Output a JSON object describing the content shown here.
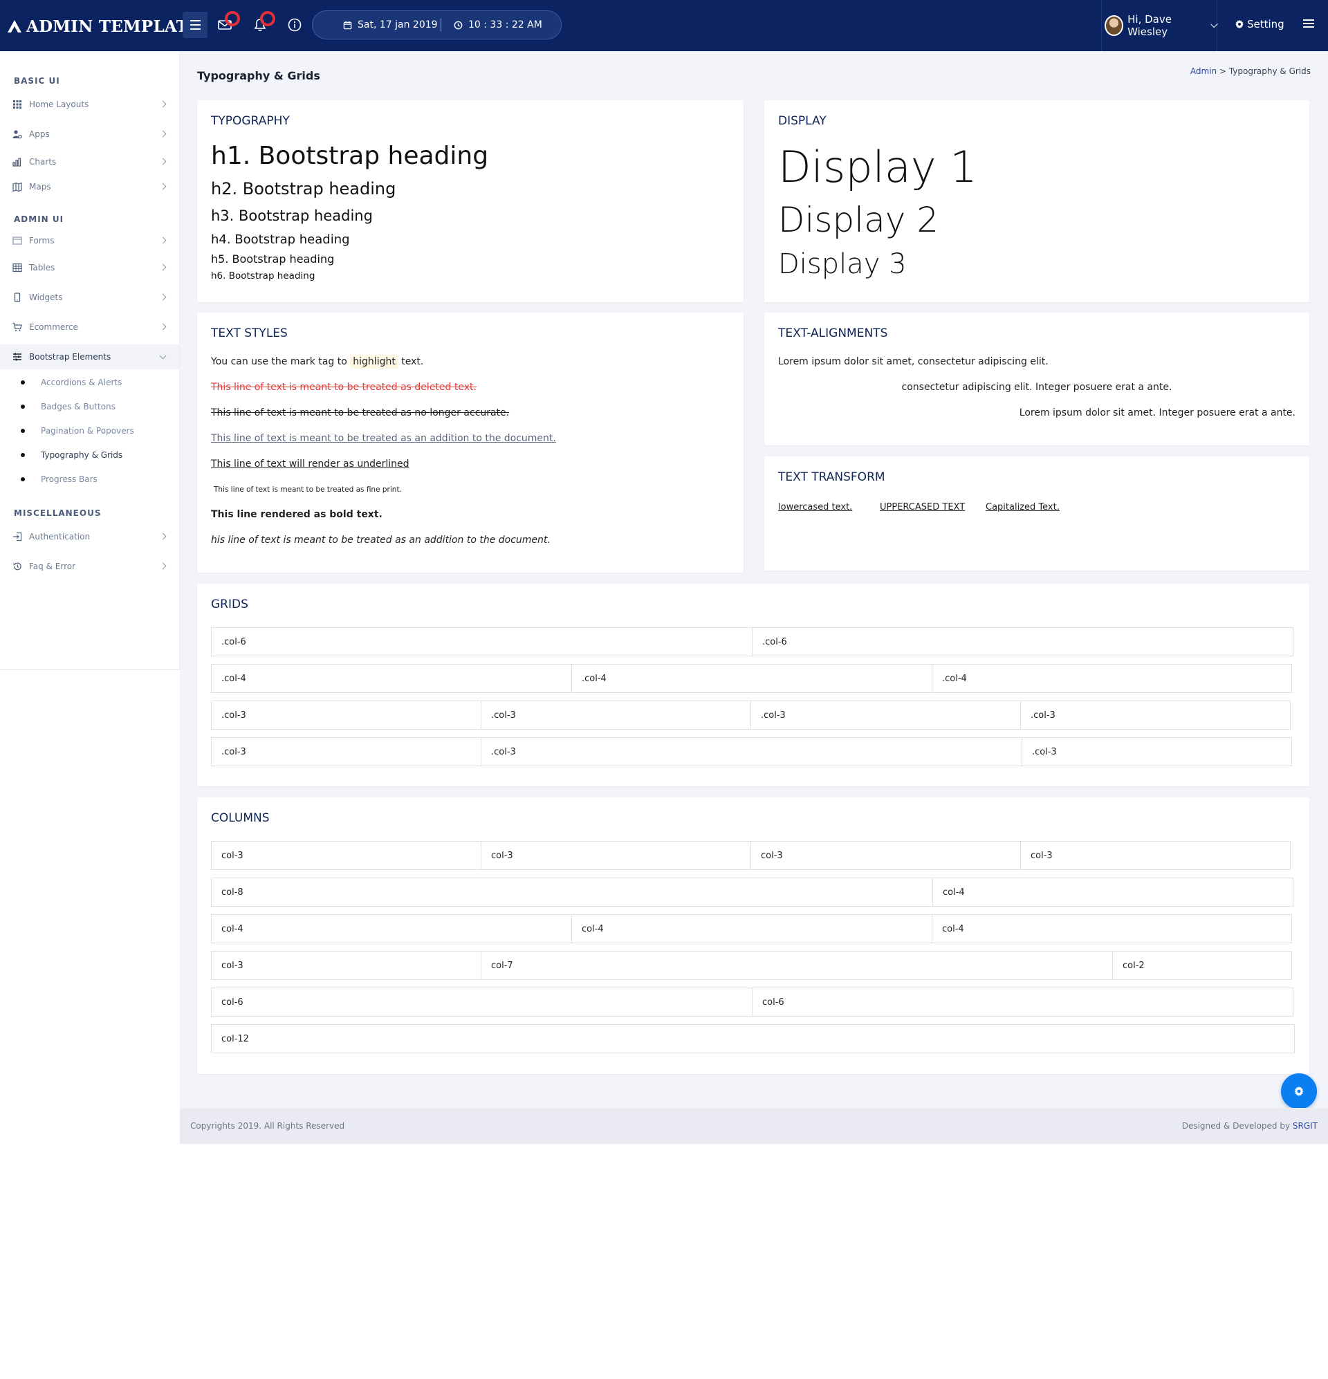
{
  "topbar": {
    "brand": "ADMIN TEMPLATE",
    "date": "Sat, 17 jan 2019",
    "time": "10 : 33 : 22 AM",
    "user_greeting": "Hi, Dave Wiesley",
    "setting_label": "Setting",
    "colors": {
      "background": "#0b2461",
      "badge": "#e0303a"
    }
  },
  "sidebar": {
    "sections": [
      {
        "title": "BASIC UI"
      },
      {
        "title": "ADMIN UI"
      },
      {
        "title": "MISCELLANEOUS"
      }
    ],
    "items": [
      {
        "label": "Home Layouts",
        "icon": "grid-icon"
      },
      {
        "label": "Apps",
        "icon": "users-icon"
      },
      {
        "label": "Charts",
        "icon": "bar-chart-icon"
      },
      {
        "label": "Maps",
        "icon": "map-icon"
      },
      {
        "label": "Forms",
        "icon": "form-icon"
      },
      {
        "label": "Tables",
        "icon": "table-icon"
      },
      {
        "label": "Widgets",
        "icon": "mobile-icon"
      },
      {
        "label": "Ecommerce",
        "icon": "cart-icon"
      },
      {
        "label": "Bootstrap Elements",
        "icon": "sliders-icon"
      },
      {
        "label": "Authentication",
        "icon": "login-icon"
      },
      {
        "label": "Faq & Error",
        "icon": "history-icon"
      }
    ],
    "sub_items": [
      {
        "label": "Accordions & Alerts"
      },
      {
        "label": "Badges & Buttons"
      },
      {
        "label": "Pagination & Popovers"
      },
      {
        "label": "Typography & Grids"
      },
      {
        "label": "Progress Bars"
      }
    ]
  },
  "page": {
    "title": "Typography & Grids",
    "breadcrumb_root": "Admin",
    "breadcrumb_sep": " > ",
    "breadcrumb_current": "Typography & Grids"
  },
  "typography": {
    "title": "TYPOGRAPHY",
    "headings": [
      "h1. Bootstrap heading",
      "h2. Bootstrap heading",
      "h3. Bootstrap heading",
      "h4. Bootstrap heading",
      "h5. Bootstrap heading",
      "h6. Bootstrap heading"
    ]
  },
  "display": {
    "title": "DISPLAY",
    "items": [
      "Display 1",
      "Display 2",
      "Display 3"
    ]
  },
  "text_styles": {
    "title": "TEXT STYLES",
    "mark_prefix": "You can use the mark tag to ",
    "mark_word": "highlight",
    "mark_suffix": " text.",
    "deleted": "This line of text is meant to be treated as deleted text.",
    "strike": "This line of text is meant to be treated as no longer accurate.",
    "inserted": "This line of text is meant to be treated as an addition to the document.",
    "underlined": "This line of text will render as underlined",
    "small": "This line of text is meant to be treated as fine print.",
    "bold": "This line rendered as bold text.",
    "italic": "his line of text is meant to be treated as an addition to the document."
  },
  "text_alignments": {
    "title": "TEXT-ALIGNMENTS",
    "left": "Lorem ipsum dolor sit amet, consectetur adipiscing elit.",
    "center": "consectetur adipiscing elit. Integer posuere erat a ante.",
    "right": "Lorem ipsum dolor sit amet. Integer posuere erat a ante."
  },
  "text_transform": {
    "title": "TEXT TRANSFORM",
    "lower": "lowercased text.",
    "upper": "UPPERCASED TEXT",
    "capitalized": "Capitalized Text."
  },
  "grids": {
    "title": "GRIDS",
    "rows": [
      [
        ".col-6",
        ".col-6"
      ],
      [
        ".col-4",
        ".col-4",
        ".col-4"
      ],
      [
        ".col-3",
        ".col-3",
        ".col-3",
        ".col-3"
      ],
      [
        ".col-3",
        ".col-3",
        ".col-3"
      ]
    ]
  },
  "columns": {
    "title": "COLUMNS",
    "rows": [
      [
        "col-3",
        "col-3",
        "col-3",
        "col-3"
      ],
      [
        "col-8",
        "col-4"
      ],
      [
        "col-4",
        "col-4",
        "col-4"
      ],
      [
        "col-3",
        "col-7",
        "col-2"
      ],
      [
        "col-6",
        "col-6"
      ],
      [
        "col-12"
      ]
    ]
  },
  "footer": {
    "copyright": "Copyrights 2019. All Rights Reserved",
    "designed_by": "Designed & Developed by ",
    "designer": "SRGIT"
  },
  "colors": {
    "accent": "#0a7ff2",
    "card_title": "#0f2557",
    "deleted_text": "#e03a3a",
    "mark_bg": "#fcf8e3"
  }
}
